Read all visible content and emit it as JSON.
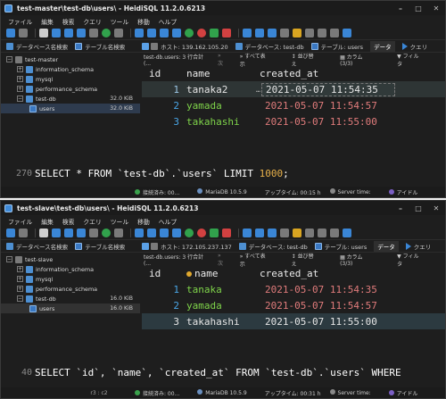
{
  "windows": [
    {
      "title": "test-master\\test-db\\users\\ - HeidiSQL 11.2.0.6213",
      "menu": [
        "ファイル",
        "編集",
        "検索",
        "クエリ",
        "ツール",
        "移動",
        "ヘルプ"
      ],
      "db_filter_label": "データベース名検索",
      "table_filter_label": "テーブル名検索",
      "tabs": {
        "host": "ホスト: 139.162.105.20",
        "database": "データベース: test-db",
        "table": "テーブル: users",
        "data": "データ",
        "query": "クエリ"
      },
      "tree": [
        {
          "label": "test-master",
          "size": ""
        },
        {
          "label": "information_schema",
          "size": ""
        },
        {
          "label": "mysql",
          "size": ""
        },
        {
          "label": "performance_schema",
          "size": ""
        },
        {
          "label": "test-db",
          "size": "32.0 KiB"
        },
        {
          "label": "users",
          "size": "32.0 KiB"
        }
      ],
      "grid_info": "test-db.users: 3 行合計 (...",
      "next_label": "次",
      "show_all_label": "すべて表示",
      "sort_label": "並び替え",
      "columns_label": "カラム (3/3)",
      "filter_label": "フィルタ",
      "headers": [
        "id",
        "name",
        "created_at"
      ],
      "rows": [
        {
          "id": "1",
          "name": "tanaka2",
          "created_at": "2021-05-07 11:54:35"
        },
        {
          "id": "2",
          "name": "yamada",
          "created_at": "2021-05-07 11:54:57"
        },
        {
          "id": "3",
          "name": "takahashi",
          "created_at": "2021-05-07 11:55:00"
        }
      ],
      "sql": {
        "line": "270",
        "pre": "SELECT * FROM `test-db`.`users` LIMIT ",
        "limit": "1000",
        "post": ";"
      },
      "status": {
        "position": "",
        "connected": "接続済み: 00...",
        "server": "MariaDB 10.5.9",
        "uptime": "アップタイム: 00:15 h",
        "server_time": "Server time:",
        "idle": "アイドル"
      }
    },
    {
      "title": "test-slave\\test-db\\users\\ - HeidiSQL 11.2.0.6213",
      "menu": [
        "ファイル",
        "編集",
        "検索",
        "クエリ",
        "ツール",
        "移動",
        "ヘルプ"
      ],
      "db_filter_label": "データベース名検索",
      "table_filter_label": "テーブル名検索",
      "tabs": {
        "host": "ホスト: 172.105.237.137",
        "database": "データベース: test-db",
        "table": "テーブル: users",
        "data": "データ",
        "query": "クエリ"
      },
      "tree": [
        {
          "label": "test-slave",
          "size": ""
        },
        {
          "label": "information_schema",
          "size": ""
        },
        {
          "label": "mysql",
          "size": ""
        },
        {
          "label": "performance_schema",
          "size": ""
        },
        {
          "label": "test-db",
          "size": "16.0 KiB"
        },
        {
          "label": "users",
          "size": "16.0 KiB"
        }
      ],
      "grid_info": "test-db.users: 3 行合計 (...",
      "next_label": "次",
      "show_all_label": "すべて表示",
      "sort_label": "並び替え",
      "columns_label": "カラム (3/3)",
      "filter_label": "フィルタ",
      "headers": [
        "id",
        "name",
        "created_at"
      ],
      "rows": [
        {
          "id": "1",
          "name": "tanaka",
          "created_at": "2021-05-07 11:54:35"
        },
        {
          "id": "2",
          "name": "yamada",
          "created_at": "2021-05-07 11:54:57"
        },
        {
          "id": "3",
          "name": "takahashi",
          "created_at": "2021-05-07 11:55:00"
        }
      ],
      "sql": {
        "line": "40",
        "pre": "SELECT `id`, `name`, `created_at` FROM `test-db`.`users` WHERE",
        "limit": "",
        "post": ""
      },
      "status": {
        "position": "r3 : c2",
        "connected": "接続済み: 00...",
        "server": "MariaDB 10.5.9",
        "uptime": "アップタイム: 00:31 h",
        "server_time": "Server time:",
        "idle": "アイドル"
      }
    }
  ]
}
